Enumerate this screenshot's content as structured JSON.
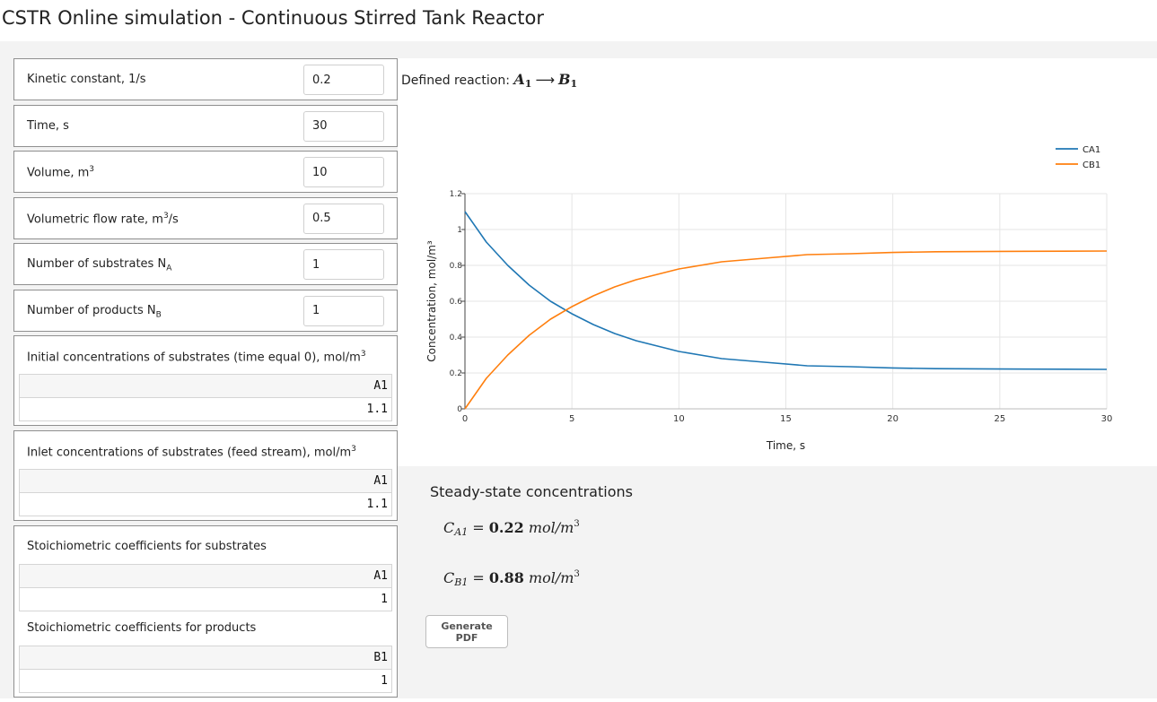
{
  "page": {
    "title": "CSTR Online simulation - Continuous Stirred Tank Reactor"
  },
  "params": {
    "kinetic": {
      "label": "Kinetic constant, 1/s",
      "value": "0.2"
    },
    "time": {
      "label": "Time, s",
      "value": "30"
    },
    "volume": {
      "label_text": "Volume, m",
      "label_sup": "3",
      "value": "10"
    },
    "flow": {
      "label_text": "Volumetric flow rate, m",
      "label_sup": "3",
      "label_tail": "/s",
      "value": "0.5"
    },
    "substrates": {
      "label_text": "Number of substrates N",
      "label_sub": "A",
      "value": "1"
    },
    "products": {
      "label_text": "Number of products N",
      "label_sub": "B",
      "value": "1"
    }
  },
  "groups": {
    "initial": {
      "label_text": "Initial concentrations of substrates (time equal 0), mol/m",
      "label_sup": "3",
      "header": "A1",
      "value": "1.1"
    },
    "inlet": {
      "label_text": "Inlet concentrations of substrates (feed stream), mol/m",
      "label_sup": "3",
      "header": "A1",
      "value": "1.1"
    },
    "stoich_sub": {
      "label": "Stoichiometric coefficients for substrates",
      "header": "A1",
      "value": "1"
    },
    "stoich_prod": {
      "label": "Stoichiometric coefficients for products",
      "header": "B1",
      "value": "1"
    }
  },
  "reaction": {
    "prefix": "Defined reaction: ",
    "lhs": "A",
    "lhs_sub": "1",
    "arrow": "⟶",
    "rhs": "B",
    "rhs_sub": "1"
  },
  "chart_data": {
    "type": "line",
    "xlabel": "Time, s",
    "ylabel": "Concentration, mol/m³",
    "xlim": [
      0,
      30
    ],
    "ylim": [
      0,
      1.2
    ],
    "xticks": [
      0,
      5,
      10,
      15,
      20,
      25,
      30
    ],
    "yticks": [
      0,
      0.2,
      0.4,
      0.6,
      0.8,
      1,
      1.2
    ],
    "grid": true,
    "legend_position": "top-right",
    "x": [
      0,
      1,
      2,
      3,
      4,
      5,
      6,
      7,
      8,
      9,
      10,
      12,
      14,
      16,
      18,
      20,
      22,
      25,
      28,
      30
    ],
    "series": [
      {
        "name": "CA1",
        "color": "#1f77b4",
        "values": [
          1.1,
          0.93,
          0.8,
          0.69,
          0.6,
          0.53,
          0.47,
          0.42,
          0.38,
          0.35,
          0.32,
          0.28,
          0.26,
          0.24,
          0.235,
          0.228,
          0.224,
          0.222,
          0.221,
          0.22
        ]
      },
      {
        "name": "CB1",
        "color": "#ff7f0e",
        "values": [
          0.0,
          0.17,
          0.3,
          0.41,
          0.5,
          0.57,
          0.63,
          0.68,
          0.72,
          0.75,
          0.78,
          0.82,
          0.84,
          0.86,
          0.865,
          0.872,
          0.876,
          0.878,
          0.879,
          0.88
        ]
      }
    ]
  },
  "steady_state": {
    "title": "Steady-state concentrations",
    "ca_var": "C",
    "ca_sub": "A1",
    "ca_eq": " = ",
    "ca_value": "0.22",
    "cb_var": "C",
    "cb_sub": "B1",
    "cb_eq": " = ",
    "cb_value": "0.88",
    "unit": "mol/m",
    "unit_sup": "3"
  },
  "buttons": {
    "generate_pdf": "Generate PDF"
  }
}
